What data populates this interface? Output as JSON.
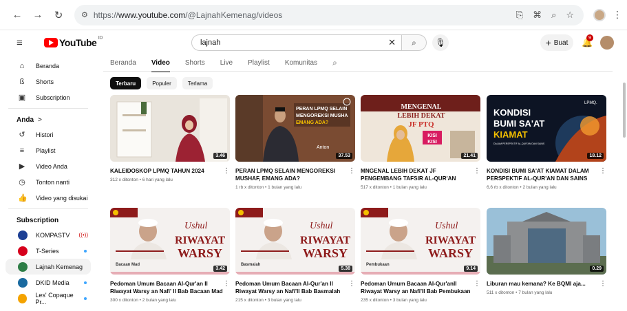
{
  "browser": {
    "url_scheme": "https://",
    "url_host": "www.youtube.com",
    "url_path": "/@LajnahKemenag/videos"
  },
  "header": {
    "logo_text": "YouTube",
    "logo_region": "ID",
    "search_value": "lajnah",
    "create_label": "Buat",
    "notif_count": "9"
  },
  "sidebar": {
    "main": [
      {
        "label": "Beranda",
        "icon": "home-icon",
        "glyph": "⌂"
      },
      {
        "label": "Shorts",
        "icon": "shorts-icon",
        "glyph": "ß"
      },
      {
        "label": "Subscription",
        "icon": "subscriptions-icon",
        "glyph": "▣"
      }
    ],
    "you_label": "Anda",
    "you_chevron": ">",
    "you": [
      {
        "label": "Histori",
        "icon": "history-icon",
        "glyph": "↺"
      },
      {
        "label": "Playlist",
        "icon": "playlist-icon",
        "glyph": "≡"
      },
      {
        "label": "Video Anda",
        "icon": "your-videos-icon",
        "glyph": "▶"
      },
      {
        "label": "Tonton nanti",
        "icon": "watch-later-icon",
        "glyph": "◷"
      },
      {
        "label": "Video yang disukai",
        "icon": "like-icon",
        "glyph": "👍"
      }
    ],
    "subs_label": "Subscription",
    "subs": [
      {
        "label": "KOMPASTV",
        "color": "#1c3f94",
        "indicator": "live"
      },
      {
        "label": "T-Series",
        "color": "#d6001c",
        "indicator": "dot"
      },
      {
        "label": "Lajnah Kemenag",
        "color": "#2d7d46",
        "indicator": "none"
      },
      {
        "label": "DKID Media",
        "color": "#1a6aa0",
        "indicator": "dot"
      },
      {
        "label": "Les' Copaque Pr...",
        "color": "#f4a300",
        "indicator": "dot"
      }
    ]
  },
  "tabs": [
    "Beranda",
    "Video",
    "Shorts",
    "Live",
    "Playlist",
    "Komunitas"
  ],
  "active_tab": "Video",
  "chips": [
    "Terbaru",
    "Populer",
    "Terlama"
  ],
  "videos": [
    {
      "title": "KALEIDOSKOP LPMQ TAHUN 2024",
      "stats": "312 x ditonton • 6 hari yang lalu",
      "duration": "3.46",
      "thumb_style": "kaleidoskop"
    },
    {
      "title": "PERAN LPMQ SELAIN MENGOREKSI MUSHAF, EMANG ADA?",
      "stats": "1 rb x ditonton • 1 bulan yang lalu",
      "duration": "37.53",
      "thumb_style": "peran",
      "thumb_text": [
        "PERAN LPMQ SELAIN",
        "MENGOREKSI MUSHA",
        "EMANG ADA?"
      ],
      "thumb_name": "Anton"
    },
    {
      "title": "MNGENAL LEBIH DEKAT JF PENGEMBANG TAFSIR AL-QUR'AN",
      "stats": "517 x ditonton • 1 bulan yang lalu",
      "duration": "21.41",
      "thumb_style": "mengenal",
      "thumb_text": [
        "MENGENAL",
        "LEBIH DEKAT",
        "JF PTQ",
        "KISI",
        "KISI"
      ]
    },
    {
      "title": "KONDISI BUMI SA'AT KIAMAT DALAM PERSPEKTIF AL-QUR'AN DAN SAINS",
      "stats": "6,6 rb x ditonton • 2 bulan yang lalu",
      "duration": "18.12",
      "thumb_style": "kondisi",
      "thumb_text": [
        "KONDISI",
        "BUMI SA'AT",
        "KIAMAT",
        "DALAM PERSPEKTIF AL-QUR'AN DAN SAINS",
        "LPMQ."
      ]
    },
    {
      "title": "Pedoman Umum Bacaan Al-Qur'an II Riwayat Warsy an Nafi' II Bab Bacaan Mad",
      "stats": "300 x ditonton • 2 bulan yang lalu",
      "duration": "3.42",
      "thumb_style": "warsy",
      "thumb_text": [
        "Ushul",
        "RIWAYAT",
        "WARSY",
        "Bacaan Mad"
      ]
    },
    {
      "title": "Pedoman Umum Bacaan Al-Qur'an II Riwayat Warsy an Nafi'II Bab Basmalah",
      "stats": "215 x ditonton • 3 bulan yang lalu",
      "duration": "5.38",
      "thumb_style": "warsy",
      "thumb_text": [
        "Ushul",
        "RIWAYAT",
        "WARSY",
        "Basmalah"
      ]
    },
    {
      "title": "Pedoman Umum Bacaan Al-Qur'anII Riwayat Warsy an Nafi'II Bab Pembukaan",
      "stats": "235 x ditonton • 3 bulan yang lalu",
      "duration": "9.14",
      "thumb_style": "warsy",
      "thumb_text": [
        "Ushul",
        "RIWAYAT",
        "WARSY",
        "Pembukaan"
      ]
    },
    {
      "title": "Liburan mau kemana? Ke BQMI aja...",
      "stats": "511 x ditonton • 7 bulan yang lalu",
      "duration": "0.29",
      "thumb_style": "building"
    }
  ]
}
